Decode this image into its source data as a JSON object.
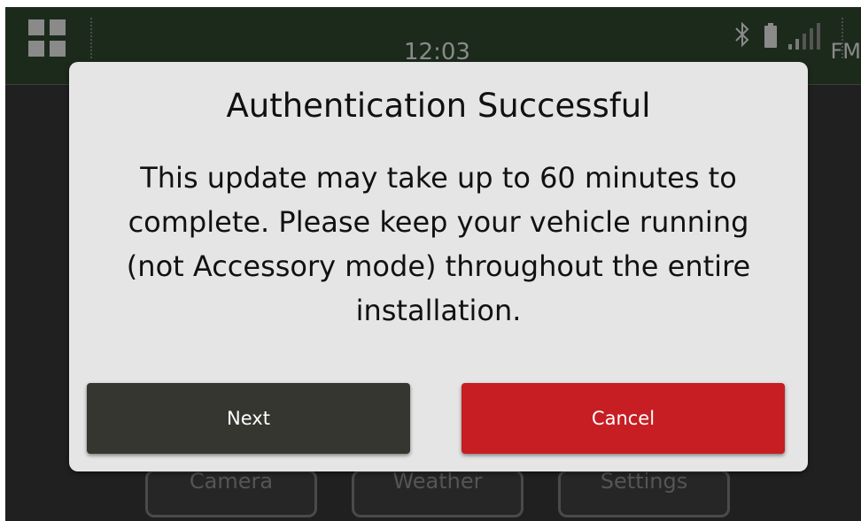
{
  "status_bar": {
    "clock": "12:03",
    "radio_source": "FM",
    "app_grid_icon": "app-grid-icon",
    "bluetooth_icon": "bluetooth-icon",
    "battery_icon": "battery-icon",
    "signal_icon": "signal-strength-icon"
  },
  "background_tiles": [
    {
      "label": "Camera"
    },
    {
      "label": "Weather"
    },
    {
      "label": "Settings"
    }
  ],
  "dialog": {
    "title": "Authentication Successful",
    "message": "This update may take up to 60 minutes to complete. Please keep your vehicle running (not Accessory mode) throughout the entire installation.",
    "next_label": "Next",
    "cancel_label": "Cancel"
  },
  "colors": {
    "status_bar_bg": "#1c2a1c",
    "dialog_bg": "#e5e5e5",
    "next_button": "#363631",
    "cancel_button": "#c61e23"
  }
}
